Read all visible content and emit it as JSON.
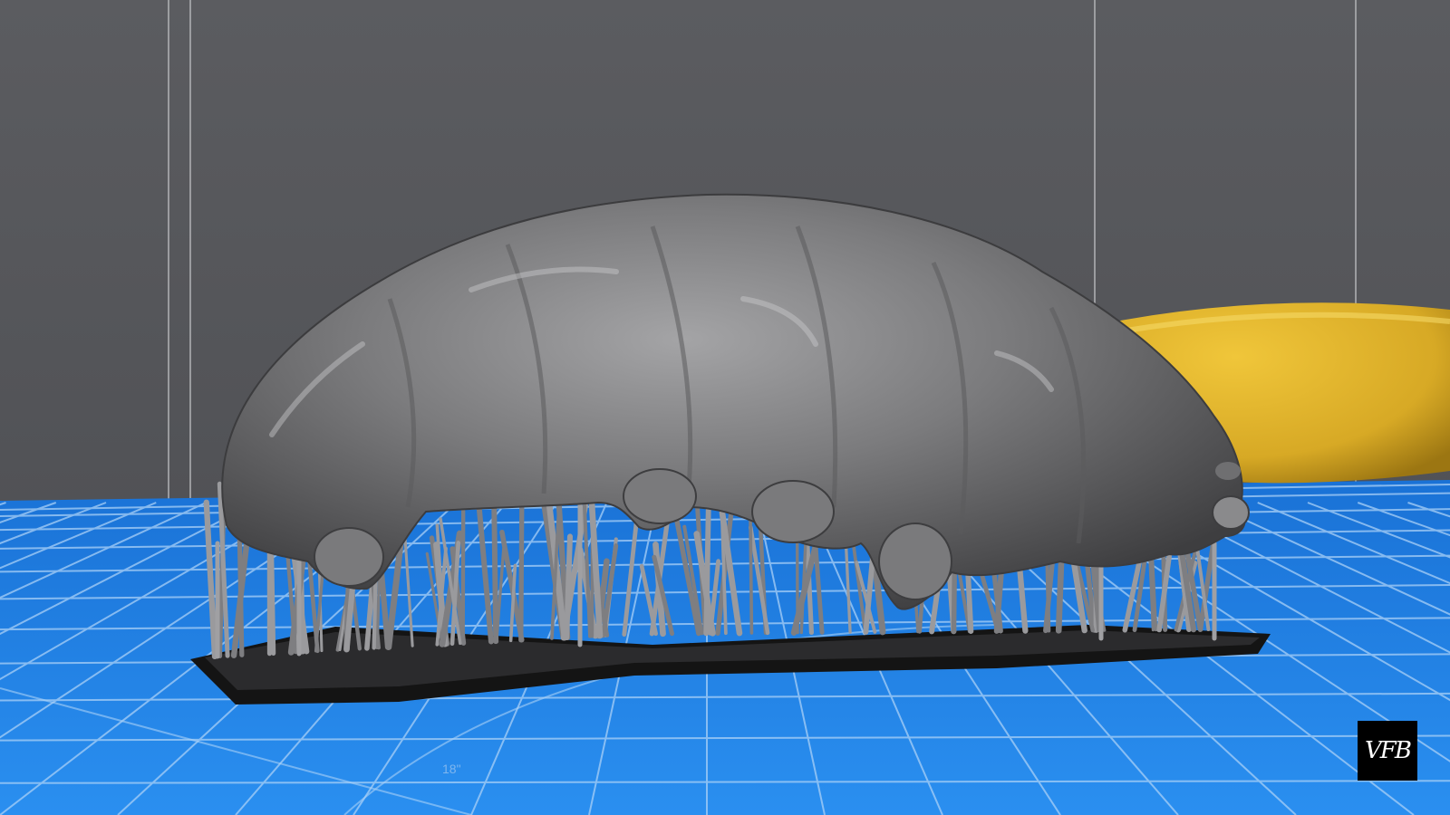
{
  "scene": {
    "background_color": "#56575b",
    "plate_color": "#1f7fe2",
    "plate_grid_color": "#9cc8f5",
    "model_color": "#7d7d7f",
    "support_color": "#8a8a8c",
    "raft_color": "#151515",
    "banana_color": "#e0b52a"
  },
  "plate": {
    "scale_label": "18\""
  },
  "model": {
    "name": "tardigrade-model"
  },
  "watermark": {
    "text": "VFB"
  }
}
